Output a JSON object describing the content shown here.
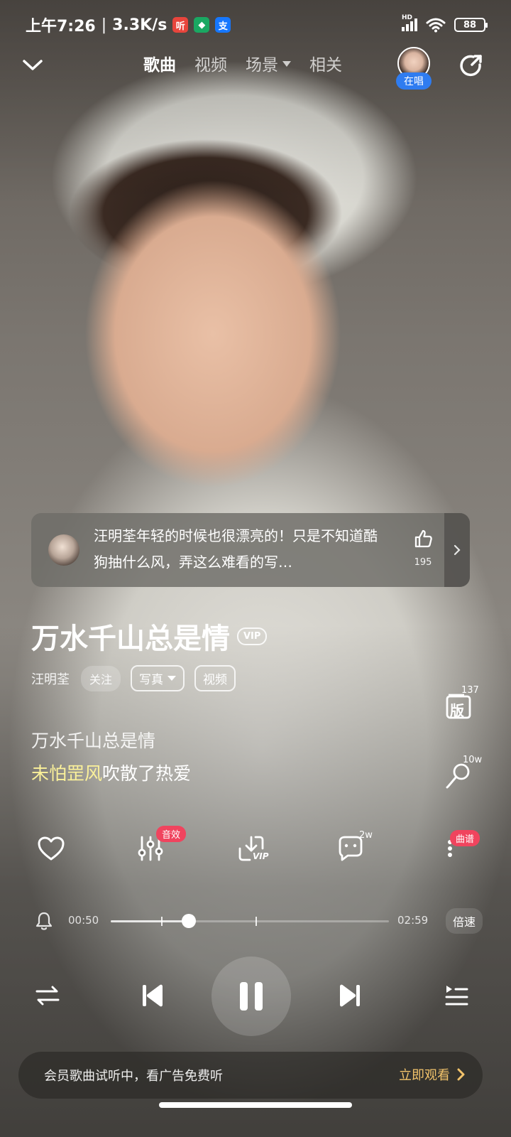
{
  "status_bar": {
    "time": "上午7:26",
    "speed": "3.3K/s",
    "app_icons": [
      {
        "name": "ting-app-icon",
        "glyph": "听",
        "color": "#e8453c"
      },
      {
        "name": "shield-app-icon",
        "glyph": "◆",
        "color": "#1aa862"
      },
      {
        "name": "alipay-app-icon",
        "glyph": "支",
        "color": "#1677ff"
      }
    ],
    "hd_label": "HD",
    "battery": "88"
  },
  "top_nav": {
    "tabs": [
      {
        "label": "歌曲",
        "active": true
      },
      {
        "label": "视频",
        "active": false
      },
      {
        "label": "场景",
        "active": false,
        "dropdown": true
      },
      {
        "label": "相关",
        "active": false
      }
    ],
    "singing_badge": "在唱"
  },
  "comment": {
    "text": "汪明荃年轻的时候也很漂亮的！只是不知道酷狗抽什么风，弄这么难看的写…",
    "likes": "195"
  },
  "song": {
    "title": "万水千山总是情",
    "vip_tag": "VIP",
    "artist": "汪明荃",
    "follow_label": "关注",
    "photo_label": "写真",
    "video_label": "视频"
  },
  "side_actions": {
    "version_label": "版",
    "version_count": "137",
    "singalong_count": "10w"
  },
  "lyrics": {
    "line1": "万水千山总是情",
    "line2_sung": "未怕罡风",
    "line2_rest": "吹散了热爱"
  },
  "actions": {
    "effect_badge": "音效",
    "comment_count": "2w",
    "score_badge": "曲谱",
    "vip_download_label": "VIP"
  },
  "player": {
    "current_time": "00:50",
    "total_time": "02:59",
    "progress": 0.28,
    "segment_start": 0.18,
    "segment_end": 0.52,
    "speed_label": "倍速"
  },
  "banner": {
    "text": "会员歌曲试听中，看广告免费听",
    "cta": "立即观看"
  },
  "colors": {
    "lyric_highlight": "#fbf19a",
    "badge_red": "#f0445e",
    "singing_blue": "#2f7cf0",
    "cta_gold": "#f2c36b"
  }
}
